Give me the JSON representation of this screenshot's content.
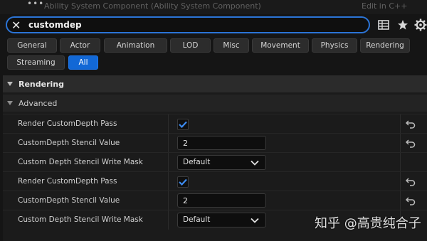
{
  "topstrip": {
    "dots": "•••",
    "clipped_left": "Ability System Component (Ability System Component)",
    "clipped_right": "Edit in C++"
  },
  "search": {
    "value": "customdep",
    "clear_icon": "close-icon",
    "accent": "#2b74d6"
  },
  "toolbar": {
    "icons": [
      "table-icon",
      "star-icon",
      "gear-icon"
    ]
  },
  "filters": {
    "buttons": [
      "General",
      "Actor",
      "Animation",
      "LOD",
      "Misc",
      "Movement",
      "Physics",
      "Rendering",
      "Streaming",
      "All"
    ],
    "active": "All",
    "active_color": "#1268d6"
  },
  "categories": {
    "main": "Rendering",
    "sub": "Advanced"
  },
  "rows": [
    {
      "label": "Render CustomDepth Pass",
      "type": "checkbox",
      "checked": true,
      "reset": true
    },
    {
      "label": "CustomDepth Stencil Value",
      "type": "number",
      "value": "2",
      "reset": true
    },
    {
      "label": "Custom Depth Stencil Write Mask",
      "type": "dropdown",
      "value": "Default",
      "reset": false
    },
    {
      "label": "Render CustomDepth Pass",
      "type": "checkbox",
      "checked": true,
      "reset": true
    },
    {
      "label": "CustomDepth Stencil Value",
      "type": "number",
      "value": "2",
      "reset": true
    },
    {
      "label": "Custom Depth Stencil Write Mask",
      "type": "dropdown",
      "value": "Default",
      "reset": false
    }
  ],
  "watermark": "知乎 @高贵纯合子"
}
